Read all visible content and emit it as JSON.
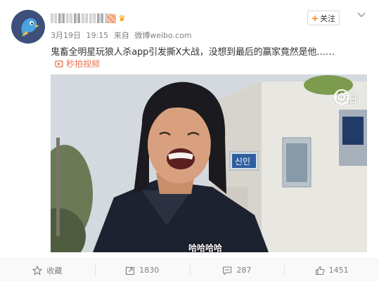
{
  "post": {
    "date": "3月19日",
    "time": "19:15",
    "source_prefix": "来自",
    "source": "微博weibo.com",
    "text": "鬼畜全明星玩狼人杀app引发撕X大战，没想到最后的赢家竟然是他……",
    "video_link_label": "秒拍视频",
    "follow_label": "关注",
    "follow_plus": "+"
  },
  "media": {
    "watermark": "秒拍",
    "subtitle": "哈哈哈哈",
    "sign_text": "신인"
  },
  "actions": {
    "favorite_label": "收藏",
    "repost_count": "1830",
    "comment_count": "287",
    "like_count": "1451"
  },
  "colors": {
    "accent_orange": "#ff8200",
    "link": "#eb7350",
    "meta_gray": "#808080"
  },
  "icons": [
    "avatar-bird-icon",
    "chevron-down-icon",
    "video-link-icon",
    "miaopai-watermark-icon",
    "star-icon",
    "repost-icon",
    "comment-icon",
    "thumbs-up-icon"
  ]
}
